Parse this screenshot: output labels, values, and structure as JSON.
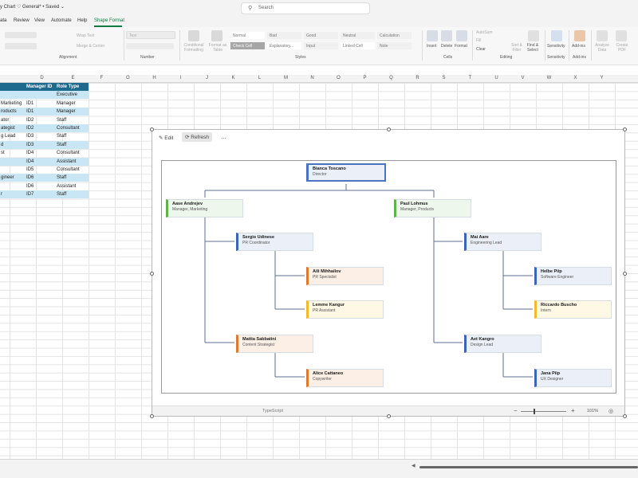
{
  "titlebar": {
    "title": "y Chart  ♡ General* • Saved ⌄",
    "search_placeholder": "Search"
  },
  "menu": {
    "tabs": [
      "ata",
      "Review",
      "View",
      "Automate",
      "Help",
      "Shape Format"
    ],
    "active": "Shape Format"
  },
  "ribbon": {
    "groups": {
      "alignment": "Alignment",
      "number": "Number",
      "styles": "Styles",
      "cells": "Cells",
      "editing": "Editing",
      "sensitivity": "Sensitivity",
      "addins": "Add-ins"
    },
    "wrap_text": "Wrap Text",
    "merge_center": "Merge & Center",
    "number_format": "Text",
    "conditional_formatting": "Conditional Formatting",
    "format_as_table": "Format as Table",
    "cell_styles": [
      "Normal",
      "Bad",
      "Good",
      "Neutral",
      "Calculation",
      "Check Cell",
      "Explanatory...",
      "Input",
      "Linked Cell",
      "Note"
    ],
    "insert": "Insert",
    "delete": "Delete",
    "format": "Format",
    "autosum": "AutoSum",
    "fill": "Fill",
    "clear": "Clear",
    "sort_filter": "Sort & Filter",
    "find_select": "Find & Select",
    "sensitivity_btn": "Sensitivity",
    "addins_btn": "Add-ins",
    "analyze_data": "Analyze Data",
    "create_pdf": "Create PDF"
  },
  "columns": [
    "D",
    "E",
    "F",
    "G",
    "H",
    "I",
    "J",
    "K",
    "L",
    "M",
    "N",
    "O",
    "P",
    "Q",
    "R",
    "S",
    "T",
    "U",
    "V",
    "W",
    "X",
    "Y"
  ],
  "sheet": {
    "headers": [
      "",
      "Manager ID",
      "Role Type"
    ],
    "rows": [
      [
        "",
        "",
        "Executive"
      ],
      [
        "Marketing",
        "ID1",
        "Manager"
      ],
      [
        "roducts",
        "ID1",
        "Manager"
      ],
      [
        "ator",
        "ID2",
        "Staff"
      ],
      [
        "ategist",
        "ID2",
        "Consultant"
      ],
      [
        "g Lead",
        "ID3",
        "Staff"
      ],
      [
        "d",
        "ID3",
        "Staff"
      ],
      [
        "st",
        "ID4",
        "Consultant"
      ],
      [
        "",
        "ID4",
        "Assistant"
      ],
      [
        "",
        "ID5",
        "Consultant"
      ],
      [
        "gineer",
        "ID6",
        "Staff"
      ],
      [
        "",
        "ID6",
        "Assistant"
      ],
      [
        "r",
        "ID7",
        "Staff"
      ]
    ]
  },
  "chart": {
    "toolbar": {
      "edit": "Edit",
      "refresh": "Refresh",
      "more": "…"
    },
    "status": {
      "source": "TypeScript",
      "zoom": "101%"
    },
    "colors": {
      "blue": "#3a64b6",
      "green": "#62b04f",
      "orange": "#e07a2e",
      "yellow": "#efbd2b",
      "connector": "#5f6f8c"
    },
    "nodes": [
      {
        "id": "bianca",
        "name": "Bianca Toscano",
        "role": "Director",
        "color": "root"
      },
      {
        "id": "aase",
        "name": "Aase Andrejev",
        "role": "Manager, Marketing",
        "color": "green"
      },
      {
        "id": "paul",
        "name": "Paul Lohmus",
        "role": "Manager, Products",
        "color": "green"
      },
      {
        "id": "sergio",
        "name": "Sergio Udinese",
        "role": "PR Coordinator",
        "color": "blue"
      },
      {
        "id": "mai",
        "name": "Mai Aare",
        "role": "Engineering Lead",
        "color": "blue"
      },
      {
        "id": "aili",
        "name": "Aili Mihhailov",
        "role": "PR Specialist",
        "color": "orange"
      },
      {
        "id": "helbe",
        "name": "Helbe Piip",
        "role": "Software Engineer",
        "color": "blue"
      },
      {
        "id": "lemme",
        "name": "Lemme Kangur",
        "role": "PR Assistant",
        "color": "yellow"
      },
      {
        "id": "riccardo",
        "name": "Riccardo Buscho",
        "role": "Intern",
        "color": "yellow"
      },
      {
        "id": "mattia",
        "name": "Mattia Sabbatini",
        "role": "Content Strategist",
        "color": "orange"
      },
      {
        "id": "aet",
        "name": "Aet Kangro",
        "role": "Design Lead",
        "color": "blue"
      },
      {
        "id": "alice",
        "name": "Alice Cattaneo",
        "role": "Copywriter",
        "color": "orange"
      },
      {
        "id": "jana",
        "name": "Jana Piip",
        "role": "UX Designer",
        "color": "blue"
      }
    ]
  }
}
